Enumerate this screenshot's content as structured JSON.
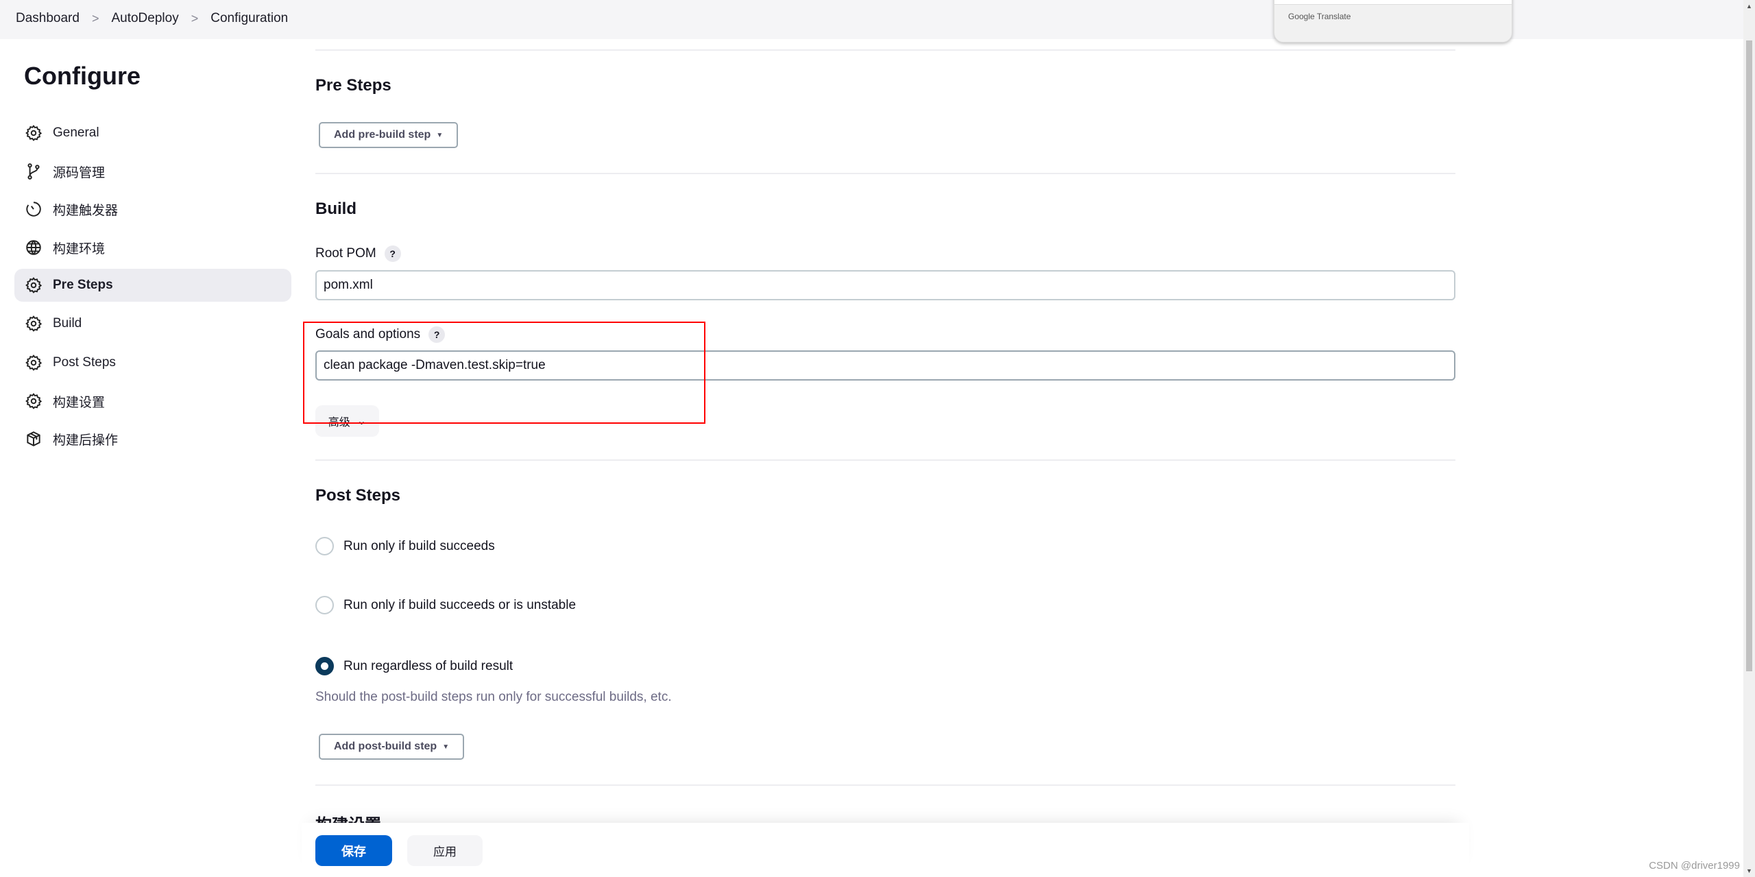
{
  "breadcrumb": [
    "Dashboard",
    "AutoDeploy",
    "Configuration"
  ],
  "translate_popup": {
    "label": "Google Translate"
  },
  "sidebar": {
    "title": "Configure",
    "items": [
      {
        "label": "General",
        "icon": "gear-icon"
      },
      {
        "label": "源码管理",
        "icon": "branch-icon"
      },
      {
        "label": "构建触发器",
        "icon": "timer-icon"
      },
      {
        "label": "构建环境",
        "icon": "globe-icon"
      },
      {
        "label": "Pre Steps",
        "icon": "gear-icon",
        "active": true
      },
      {
        "label": "Build",
        "icon": "gear-icon"
      },
      {
        "label": "Post Steps",
        "icon": "gear-icon"
      },
      {
        "label": "构建设置",
        "icon": "gear-icon"
      },
      {
        "label": "构建后操作",
        "icon": "package-icon"
      }
    ]
  },
  "pre_steps": {
    "heading": "Pre Steps",
    "add_button": "Add pre-build step"
  },
  "build": {
    "heading": "Build",
    "root_pom": {
      "label": "Root POM",
      "help": "?",
      "value": "pom.xml"
    },
    "goals": {
      "label": "Goals and options",
      "help": "?",
      "value": "clean package -Dmaven.test.skip=true"
    },
    "advanced": "高级"
  },
  "post_steps": {
    "heading": "Post Steps",
    "options": [
      {
        "label": "Run only if build succeeds",
        "selected": false
      },
      {
        "label": "Run only if build succeeds or is unstable",
        "selected": false
      },
      {
        "label": "Run regardless of build result",
        "selected": true
      }
    ],
    "description": "Should the post-build steps run only for successful builds, etc.",
    "add_button": "Add post-build step"
  },
  "next_section": {
    "heading": "构建设置"
  },
  "actions": {
    "save": "保存",
    "apply": "应用"
  },
  "watermark": "CSDN @driver1999",
  "colors": {
    "primary": "#0063d2",
    "radio_selected": "#0b3a5c",
    "highlight_box": "#ff0000"
  }
}
